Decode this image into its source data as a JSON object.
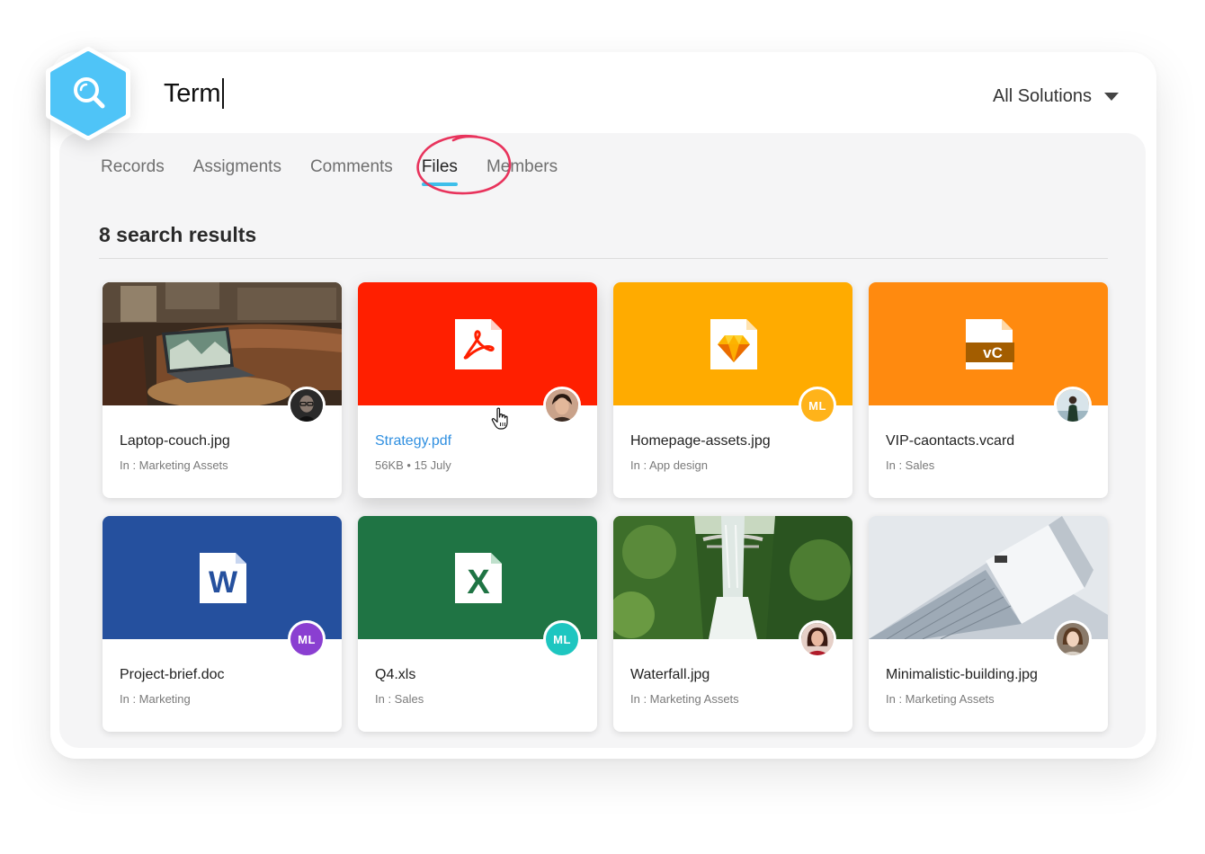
{
  "search": {
    "query": "Term"
  },
  "filter": {
    "selected": "All Solutions"
  },
  "tabs": [
    {
      "label": "Records"
    },
    {
      "label": "Assigments"
    },
    {
      "label": "Comments"
    },
    {
      "label": "Files",
      "active": true
    },
    {
      "label": "Members"
    }
  ],
  "results": {
    "title": "8 search results",
    "items": [
      {
        "name": "Laptop-couch.jpg",
        "meta": "In : Marketing Assets",
        "thumb": "photo-laptop",
        "avatar": "photo-man-glasses"
      },
      {
        "name": "Strategy.pdf",
        "meta": "56KB • 15 July",
        "thumb": "pdf-icon",
        "thumb_color": "#ff1f00",
        "avatar": "photo-woman-short-hair",
        "hovered": true
      },
      {
        "name": "Homepage-assets.jpg",
        "meta": "In : App design",
        "thumb": "sketch-icon",
        "thumb_color": "#ffab00",
        "avatar": "initials",
        "initials": "ML",
        "avatar_color": "#ffb31a"
      },
      {
        "name": "VIP-caontacts.vcard",
        "meta": "In : Sales",
        "thumb": "vcard-icon",
        "thumb_color": "#ff8a0f",
        "avatar": "photo-man-outdoor"
      },
      {
        "name": "Project-brief.doc",
        "meta": "In : Marketing",
        "thumb": "word-icon",
        "thumb_color": "#25509e",
        "avatar": "initials",
        "initials": "ML",
        "avatar_color": "#8a3fd1"
      },
      {
        "name": "Q4.xls",
        "meta": "In : Sales",
        "thumb": "excel-icon",
        "thumb_color": "#1f7444",
        "avatar": "initials",
        "initials": "ML",
        "avatar_color": "#1ec6c0"
      },
      {
        "name": "Waterfall.jpg",
        "meta": "In : Marketing Assets",
        "thumb": "photo-waterfall",
        "avatar": "photo-woman-red"
      },
      {
        "name": "Minimalistic-building.jpg",
        "meta": "In : Marketing Assets",
        "thumb": "photo-building",
        "avatar": "photo-woman-light"
      }
    ]
  },
  "colors": {
    "accent": "#3ebfea",
    "hex_badge": "#4fc4f7",
    "annotation_circle": "#e8335c",
    "link": "#2f8fe0"
  }
}
